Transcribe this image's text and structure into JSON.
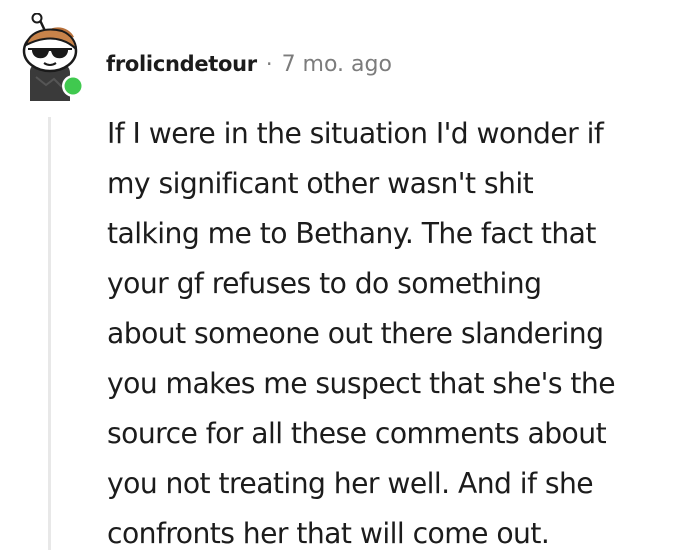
{
  "comment": {
    "author": "frolicndetour",
    "separator": "·",
    "timestamp": "7 mo. ago",
    "online_indicator_color": "#40c94f",
    "avatar_icon": "snoo-sunglasses-avatar",
    "body_lines": [
      "If I were in the situation I'd wonder if",
      "my significant other wasn't shit",
      "talking me to Bethany. The fact that",
      "your gf refuses to do something",
      "about someone out there slandering",
      "you makes me suspect that she's the",
      "source for all these comments about",
      "you not treating her well. And if she",
      "confronts her that will come out."
    ]
  }
}
